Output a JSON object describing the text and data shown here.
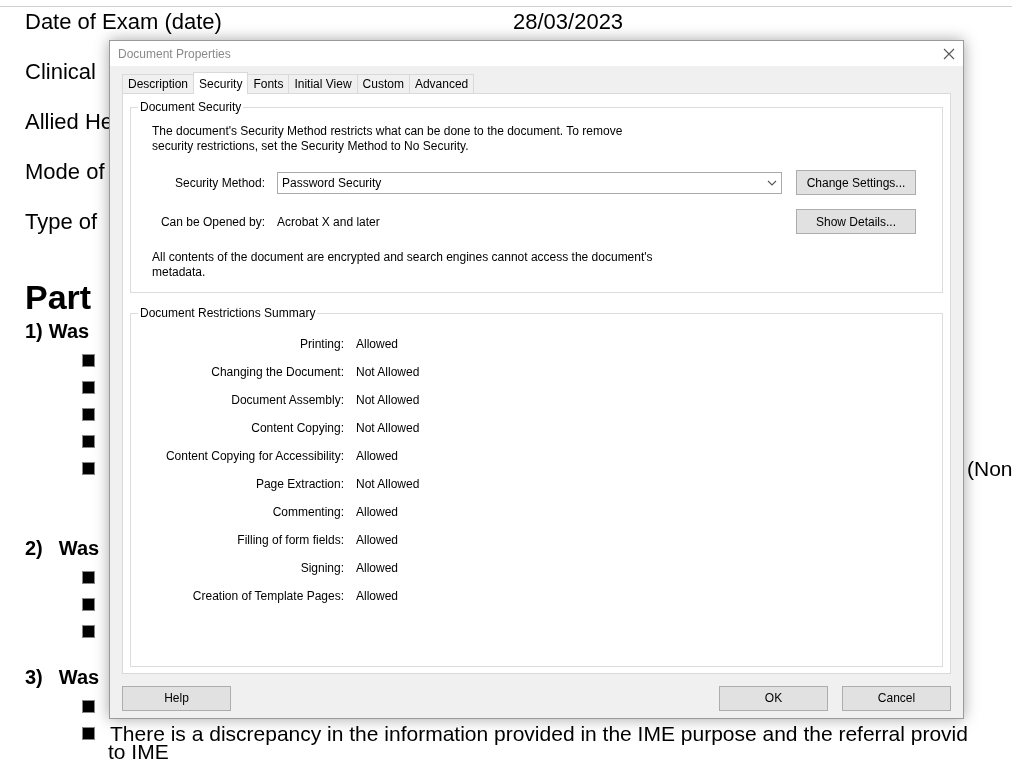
{
  "document": {
    "fields": [
      {
        "label": "Date of Exam (date)",
        "value": "28/03/2023"
      },
      {
        "label": "Clinical"
      },
      {
        "label": "Allied He"
      },
      {
        "label": "Mode of"
      },
      {
        "label": "Type of"
      }
    ],
    "heading": "Part",
    "questions": [
      {
        "number": "1)",
        "title": "Was",
        "items": [
          {
            "kind": "bullet"
          },
          {
            "kind": "bullet"
          },
          {
            "kind": "bullet"
          },
          {
            "kind": "bullet"
          },
          {
            "kind": "bullet",
            "far_text": "(Non"
          }
        ]
      },
      {
        "number": "2)",
        "title": "Was",
        "items": [
          {
            "kind": "bullet"
          },
          {
            "kind": "bullet"
          },
          {
            "kind": "bullet"
          }
        ]
      },
      {
        "number": "3)",
        "title": "Was",
        "items": [
          {
            "kind": "bullet"
          },
          {
            "kind": "bullet",
            "text": "There is a discrepancy in the information provided in the IME purpose and the referral provid",
            "continuation": "to IME"
          }
        ]
      }
    ]
  },
  "dialog": {
    "title": "Document Properties",
    "tabs": [
      {
        "label": "Description",
        "selected": false
      },
      {
        "label": "Security",
        "selected": true
      },
      {
        "label": "Fonts",
        "selected": false
      },
      {
        "label": "Initial View",
        "selected": false
      },
      {
        "label": "Custom",
        "selected": false
      },
      {
        "label": "Advanced",
        "selected": false
      }
    ],
    "security": {
      "group_title": "Document Security",
      "description": "The document's Security Method restricts what can be done to the document. To remove security restrictions, set the Security Method to No Security.",
      "method_label": "Security Method:",
      "method_value": "Password Security",
      "change_button": "Change Settings...",
      "opened_label": "Can be Opened by:",
      "opened_value": "Acrobat X and later",
      "details_button": "Show Details...",
      "note": "All contents of the document are encrypted and search engines cannot access the document's metadata."
    },
    "restrictions": {
      "group_title": "Document Restrictions Summary",
      "rows": [
        {
          "label": "Printing:",
          "value": "Allowed"
        },
        {
          "label": "Changing the Document:",
          "value": "Not Allowed"
        },
        {
          "label": "Document Assembly:",
          "value": "Not Allowed"
        },
        {
          "label": "Content Copying:",
          "value": "Not Allowed"
        },
        {
          "label": "Content Copying for Accessibility:",
          "value": "Allowed"
        },
        {
          "label": "Page Extraction:",
          "value": "Not Allowed"
        },
        {
          "label": "Commenting:",
          "value": "Allowed"
        },
        {
          "label": "Filling of form fields:",
          "value": "Allowed"
        },
        {
          "label": "Signing:",
          "value": "Allowed"
        },
        {
          "label": "Creation of Template Pages:",
          "value": "Allowed"
        }
      ]
    },
    "buttons": {
      "help": "Help",
      "ok": "OK",
      "cancel": "Cancel"
    }
  }
}
